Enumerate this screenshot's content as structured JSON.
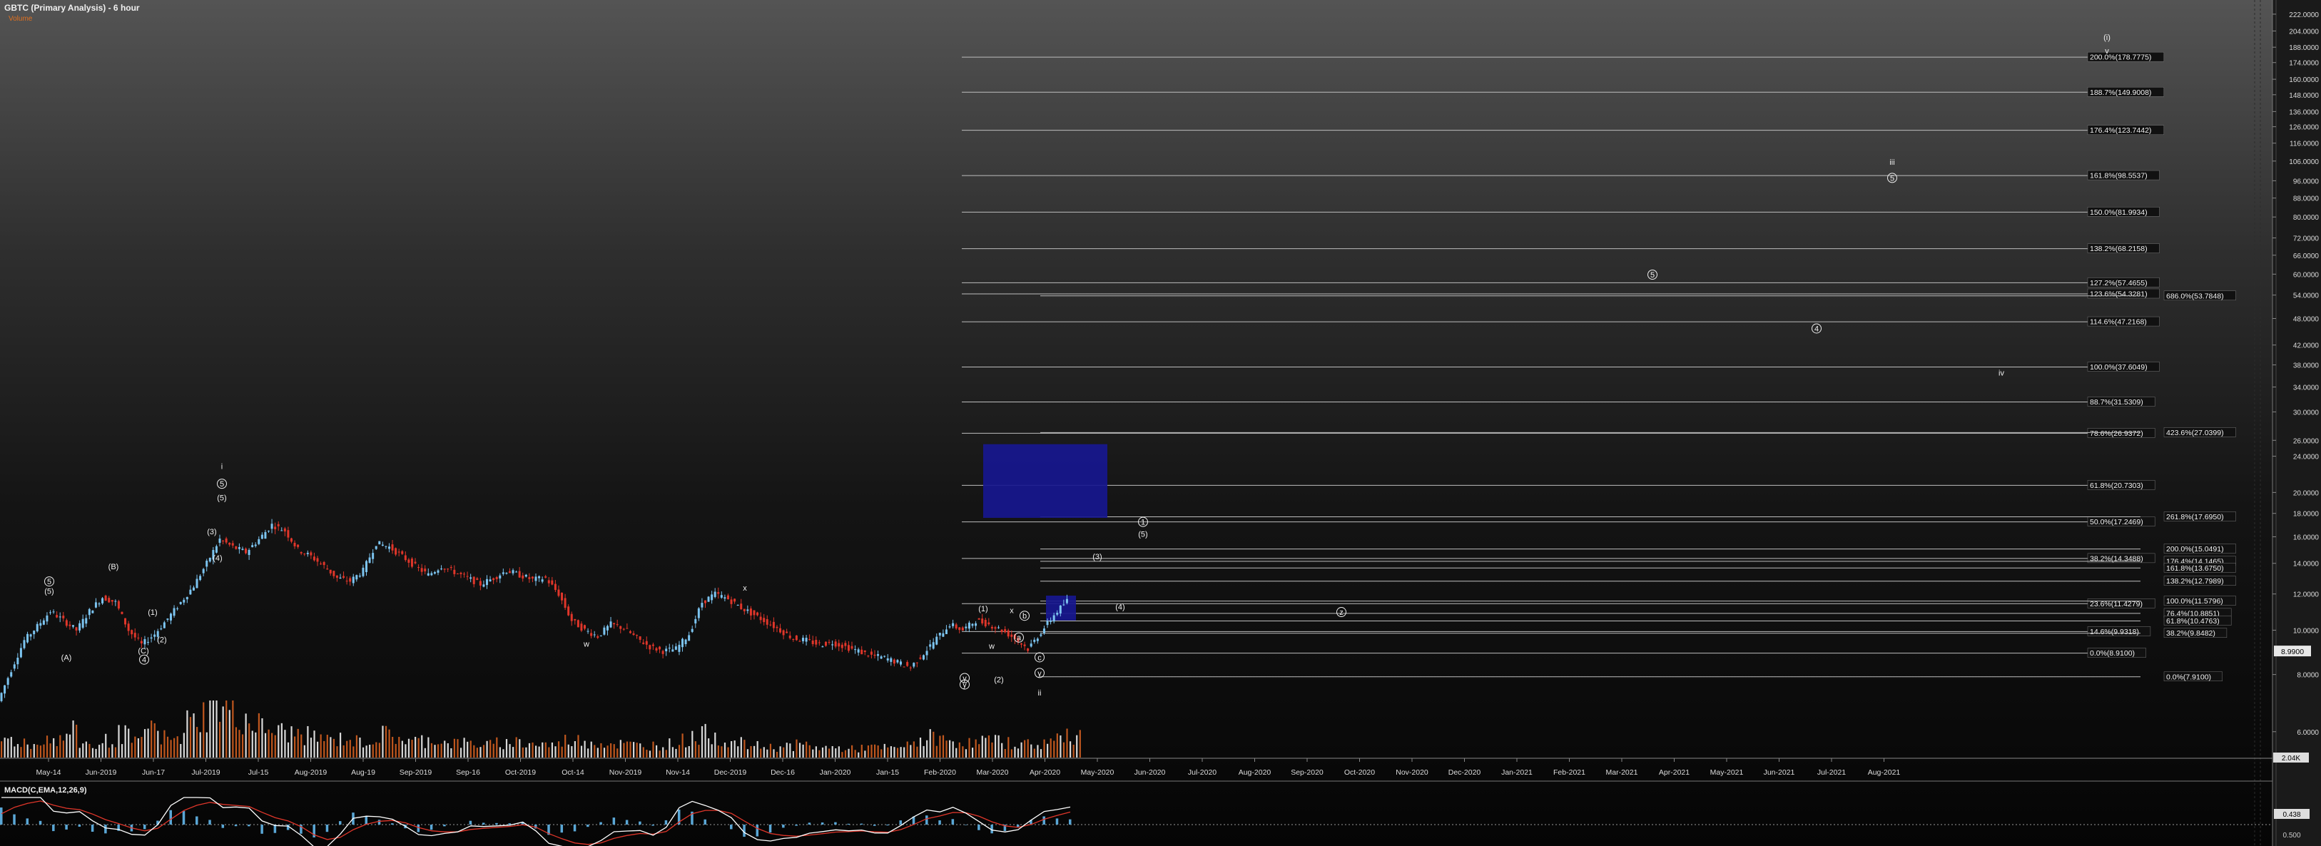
{
  "header": {
    "title": "GBTC (Primary Analysis) - 6 hour",
    "volume_label": "Volume",
    "macd_label": "MACD(C,EMA,12,26,9)"
  },
  "colors": {
    "up_candle": "#7cc4f0",
    "down_candle": "#e0362a",
    "line": "#bdbdbd",
    "zone": "#17178f",
    "macd_line": "#ffffff",
    "signal_line": "#e0362a",
    "histogram": "#5aa7d6"
  },
  "chart_data": {
    "type": "candlestick",
    "y_scale": "log",
    "ylim": [
      5.5,
      230
    ],
    "y_ticks": [
      "222.0000",
      "204.0000",
      "188.0000",
      "174.0000",
      "160.0000",
      "148.0000",
      "136.0000",
      "126.0000",
      "116.0000",
      "106.0000",
      "96.0000",
      "88.0000",
      "80.0000",
      "72.0000",
      "66.0000",
      "60.0000",
      "54.0000",
      "48.0000",
      "42.0000",
      "38.0000",
      "34.0000",
      "30.0000",
      "26.0000",
      "24.0000",
      "20.0000",
      "18.0000",
      "16.0000",
      "14.0000",
      "12.0000",
      "10.0000",
      "8.0000",
      "6.0000"
    ],
    "x_ticks": [
      "May-14",
      "Jun-2019",
      "Jun-17",
      "Jul-2019",
      "Jul-15",
      "Aug-2019",
      "Aug-19",
      "Sep-2019",
      "Sep-16",
      "Oct-2019",
      "Oct-14",
      "Nov-2019",
      "Nov-14",
      "Dec-2019",
      "Dec-16",
      "Jan-2020",
      "Jan-15",
      "Feb-2020",
      "Mar-2020",
      "Apr-2020",
      "May-2020",
      "Jun-2020",
      "Jul-2020",
      "Aug-2020",
      "Sep-2020",
      "Oct-2020",
      "Nov-2020",
      "Dec-2020",
      "Jan-2021",
      "Feb-2021",
      "Mar-2021",
      "Apr-2021",
      "May-2021",
      "Jun-2021",
      "Jul-2021",
      "Aug-2021"
    ],
    "price_path": [
      7.0,
      8.2,
      9.5,
      10.2,
      11.0,
      10.5,
      10.0,
      11.0,
      11.8,
      11.5,
      10.0,
      9.3,
      9.8,
      10.6,
      11.5,
      12.5,
      14.0,
      15.8,
      15.2,
      14.8,
      15.8,
      17.0,
      16.5,
      15.0,
      14.5,
      13.8,
      13.0,
      12.8,
      13.5,
      15.5,
      15.2,
      14.5,
      13.8,
      13.2,
      13.8,
      13.4,
      13.0,
      12.6,
      13.0,
      13.5,
      13.2,
      12.9,
      13.0,
      12.0,
      10.5,
      10.0,
      9.7,
      10.3,
      10.1,
      9.6,
      9.2,
      9.0,
      9.1,
      9.8,
      11.5,
      12.0,
      11.7,
      11.2,
      10.8,
      10.4,
      10.0,
      9.6,
      9.5,
      9.3,
      9.4,
      9.2,
      9.0,
      8.8,
      8.7,
      8.5,
      8.3,
      8.9,
      9.6,
      10.3,
      10.0,
      10.5,
      10.3,
      10.0,
      9.6,
      9.1,
      9.9,
      10.8,
      11.6
    ],
    "volume": [
      0.32,
      0.28,
      0.22,
      0.35,
      0.3,
      0.45,
      0.25,
      0.2,
      0.3,
      0.4,
      0.26,
      0.55,
      0.35,
      0.3,
      0.62,
      0.75,
      0.95,
      0.85,
      0.7,
      0.6,
      0.5,
      0.45,
      0.42,
      0.38,
      0.35,
      0.3,
      0.33,
      0.28,
      0.3,
      0.4,
      0.36,
      0.28,
      0.3,
      0.32,
      0.26,
      0.25,
      0.24,
      0.22,
      0.25,
      0.28,
      0.24,
      0.23,
      0.22,
      0.3,
      0.3,
      0.28,
      0.25,
      0.24,
      0.22,
      0.2,
      0.22,
      0.24,
      0.3,
      0.38,
      0.42,
      0.3,
      0.25,
      0.22,
      0.2,
      0.18,
      0.2,
      0.22,
      0.18,
      0.17,
      0.16,
      0.15,
      0.18,
      0.17,
      0.16,
      0.2,
      0.3,
      0.35,
      0.3,
      0.28,
      0.25,
      0.3,
      0.28,
      0.26,
      0.24,
      0.22,
      0.28,
      0.35,
      0.4
    ],
    "volume_readout": "2.04K",
    "macd_readout": "0.438",
    "macd_axis_label": "0.500",
    "last_price_badge": "8.9900",
    "fib_lines": [
      {
        "label": "200.0%(178.7775)",
        "price": 178.7775,
        "start": "early"
      },
      {
        "label": "188.7%(149.9008)",
        "price": 149.9008,
        "start": "early"
      },
      {
        "label": "176.4%(123.7442)",
        "price": 123.7442,
        "start": "early"
      },
      {
        "label": "161.8%(98.5537)",
        "price": 98.5537,
        "start": "early"
      },
      {
        "label": "150.0%(81.9934)",
        "price": 81.9934,
        "start": "early"
      },
      {
        "label": "138.2%(68.2158)",
        "price": 68.2158,
        "start": "early"
      },
      {
        "label": "127.2%(57.4655)",
        "price": 57.4655,
        "start": "early"
      },
      {
        "label": "123.6%(54.3281)",
        "price": 54.3281,
        "start": "early"
      },
      {
        "label": "114.6%(47.2168)",
        "price": 47.2168,
        "start": "early"
      },
      {
        "label": "100.0%(37.6049)",
        "price": 37.6049,
        "start": "early"
      },
      {
        "label": "88.7%(31.5309)",
        "price": 31.5309,
        "start": "early"
      },
      {
        "label": "78.6%(26.9372)",
        "price": 26.9372,
        "start": "early"
      },
      {
        "label": "61.8%(20.7303)",
        "price": 20.7303,
        "start": "early"
      },
      {
        "label": "50.0%(17.2469)",
        "price": 17.2469,
        "start": "early"
      },
      {
        "label": "38.2%(14.3488)",
        "price": 14.3488,
        "start": "early"
      },
      {
        "label": "23.6%(11.4279)",
        "price": 11.4279,
        "start": "early"
      },
      {
        "label": "14.6%(9.9318)",
        "price": 9.9318,
        "start": "early"
      },
      {
        "label": "0.0%(8.9100)",
        "price": 8.91,
        "start": "early"
      },
      {
        "label": "0.0%(7.9100)",
        "price": 7.91,
        "start": "late"
      },
      {
        "label": "686.0%(53.7848)",
        "price": 53.7848,
        "start": "late"
      },
      {
        "label": "423.6%(27.0399)",
        "price": 27.0399,
        "start": "late"
      },
      {
        "label": "261.8%(17.6950)",
        "price": 17.695,
        "start": "late"
      },
      {
        "label": "200.0%(15.0491)",
        "price": 15.0491,
        "start": "late"
      },
      {
        "label": "176.4%(14.1465)",
        "price": 14.1465,
        "start": "late"
      },
      {
        "label": "161.8%(13.6750)",
        "price": 13.675,
        "start": "late"
      },
      {
        "label": "138.2%(12.7989)",
        "price": 12.7989,
        "start": "late"
      },
      {
        "label": "100.0%(11.5796)",
        "price": 11.5796,
        "start": "late"
      },
      {
        "label": "76.4%(10.8851)",
        "price": 10.8851,
        "start": "late"
      },
      {
        "label": "61.8%(10.4763)",
        "price": 10.4763,
        "start": "late"
      },
      {
        "label": "38.2%(9.8482)",
        "price": 9.8482,
        "start": "late"
      }
    ],
    "annotations": [
      {
        "text": "(i)",
        "price": 195
      },
      {
        "text": "v",
        "price": 182
      },
      {
        "text": "iii",
        "price": 104
      },
      {
        "text": "5",
        "price": 96
      },
      {
        "text": "5",
        "price": 59
      },
      {
        "text": "4",
        "price": 45
      },
      {
        "text": "iv",
        "price": 36
      },
      {
        "text": "i",
        "price": 22.5
      },
      {
        "text": "5",
        "price": 20.6
      },
      {
        "text": "(5)",
        "price": 19.2
      },
      {
        "text": "(3)",
        "price": 16.2
      },
      {
        "text": "(4)",
        "price": 14.2
      },
      {
        "text": "5",
        "price": 12.6
      },
      {
        "text": "(5)",
        "price": 12.0
      },
      {
        "text": "(B)",
        "price": 13.6
      },
      {
        "text": "(1)",
        "price": 10.8
      },
      {
        "text": "(2)",
        "price": 9.4
      },
      {
        "text": "(C)",
        "price": 8.9
      },
      {
        "text": "4",
        "price": 8.5
      },
      {
        "text": "(A)",
        "price": 8.6
      },
      {
        "text": "x",
        "price": 12.2
      },
      {
        "text": "w",
        "price": 9.2
      },
      {
        "text": "1",
        "price": 17.0
      },
      {
        "text": "(5)",
        "price": 16.0
      },
      {
        "text": "(3)",
        "price": 14.3
      },
      {
        "text": "(4)",
        "price": 11.1
      },
      {
        "text": "z",
        "price": 10.8
      },
      {
        "text": "(1)",
        "price": 11.0
      },
      {
        "text": "x",
        "price": 10.9
      },
      {
        "text": "b",
        "price": 10.6
      },
      {
        "text": "w",
        "price": 9.1
      },
      {
        "text": "a",
        "price": 9.5
      },
      {
        "text": "c",
        "price": 8.6
      },
      {
        "text": "y",
        "price": 7.95
      },
      {
        "text": "y",
        "price": 7.75
      },
      {
        "text": "y",
        "price": 7.5
      },
      {
        "text": "ii",
        "price": 7.2
      },
      {
        "text": "(2)",
        "price": 7.7
      }
    ],
    "zones": [
      {
        "price_top": 25.5,
        "price_bottom": 17.6
      },
      {
        "price_top": 11.9,
        "price_bottom": 10.5
      }
    ]
  }
}
